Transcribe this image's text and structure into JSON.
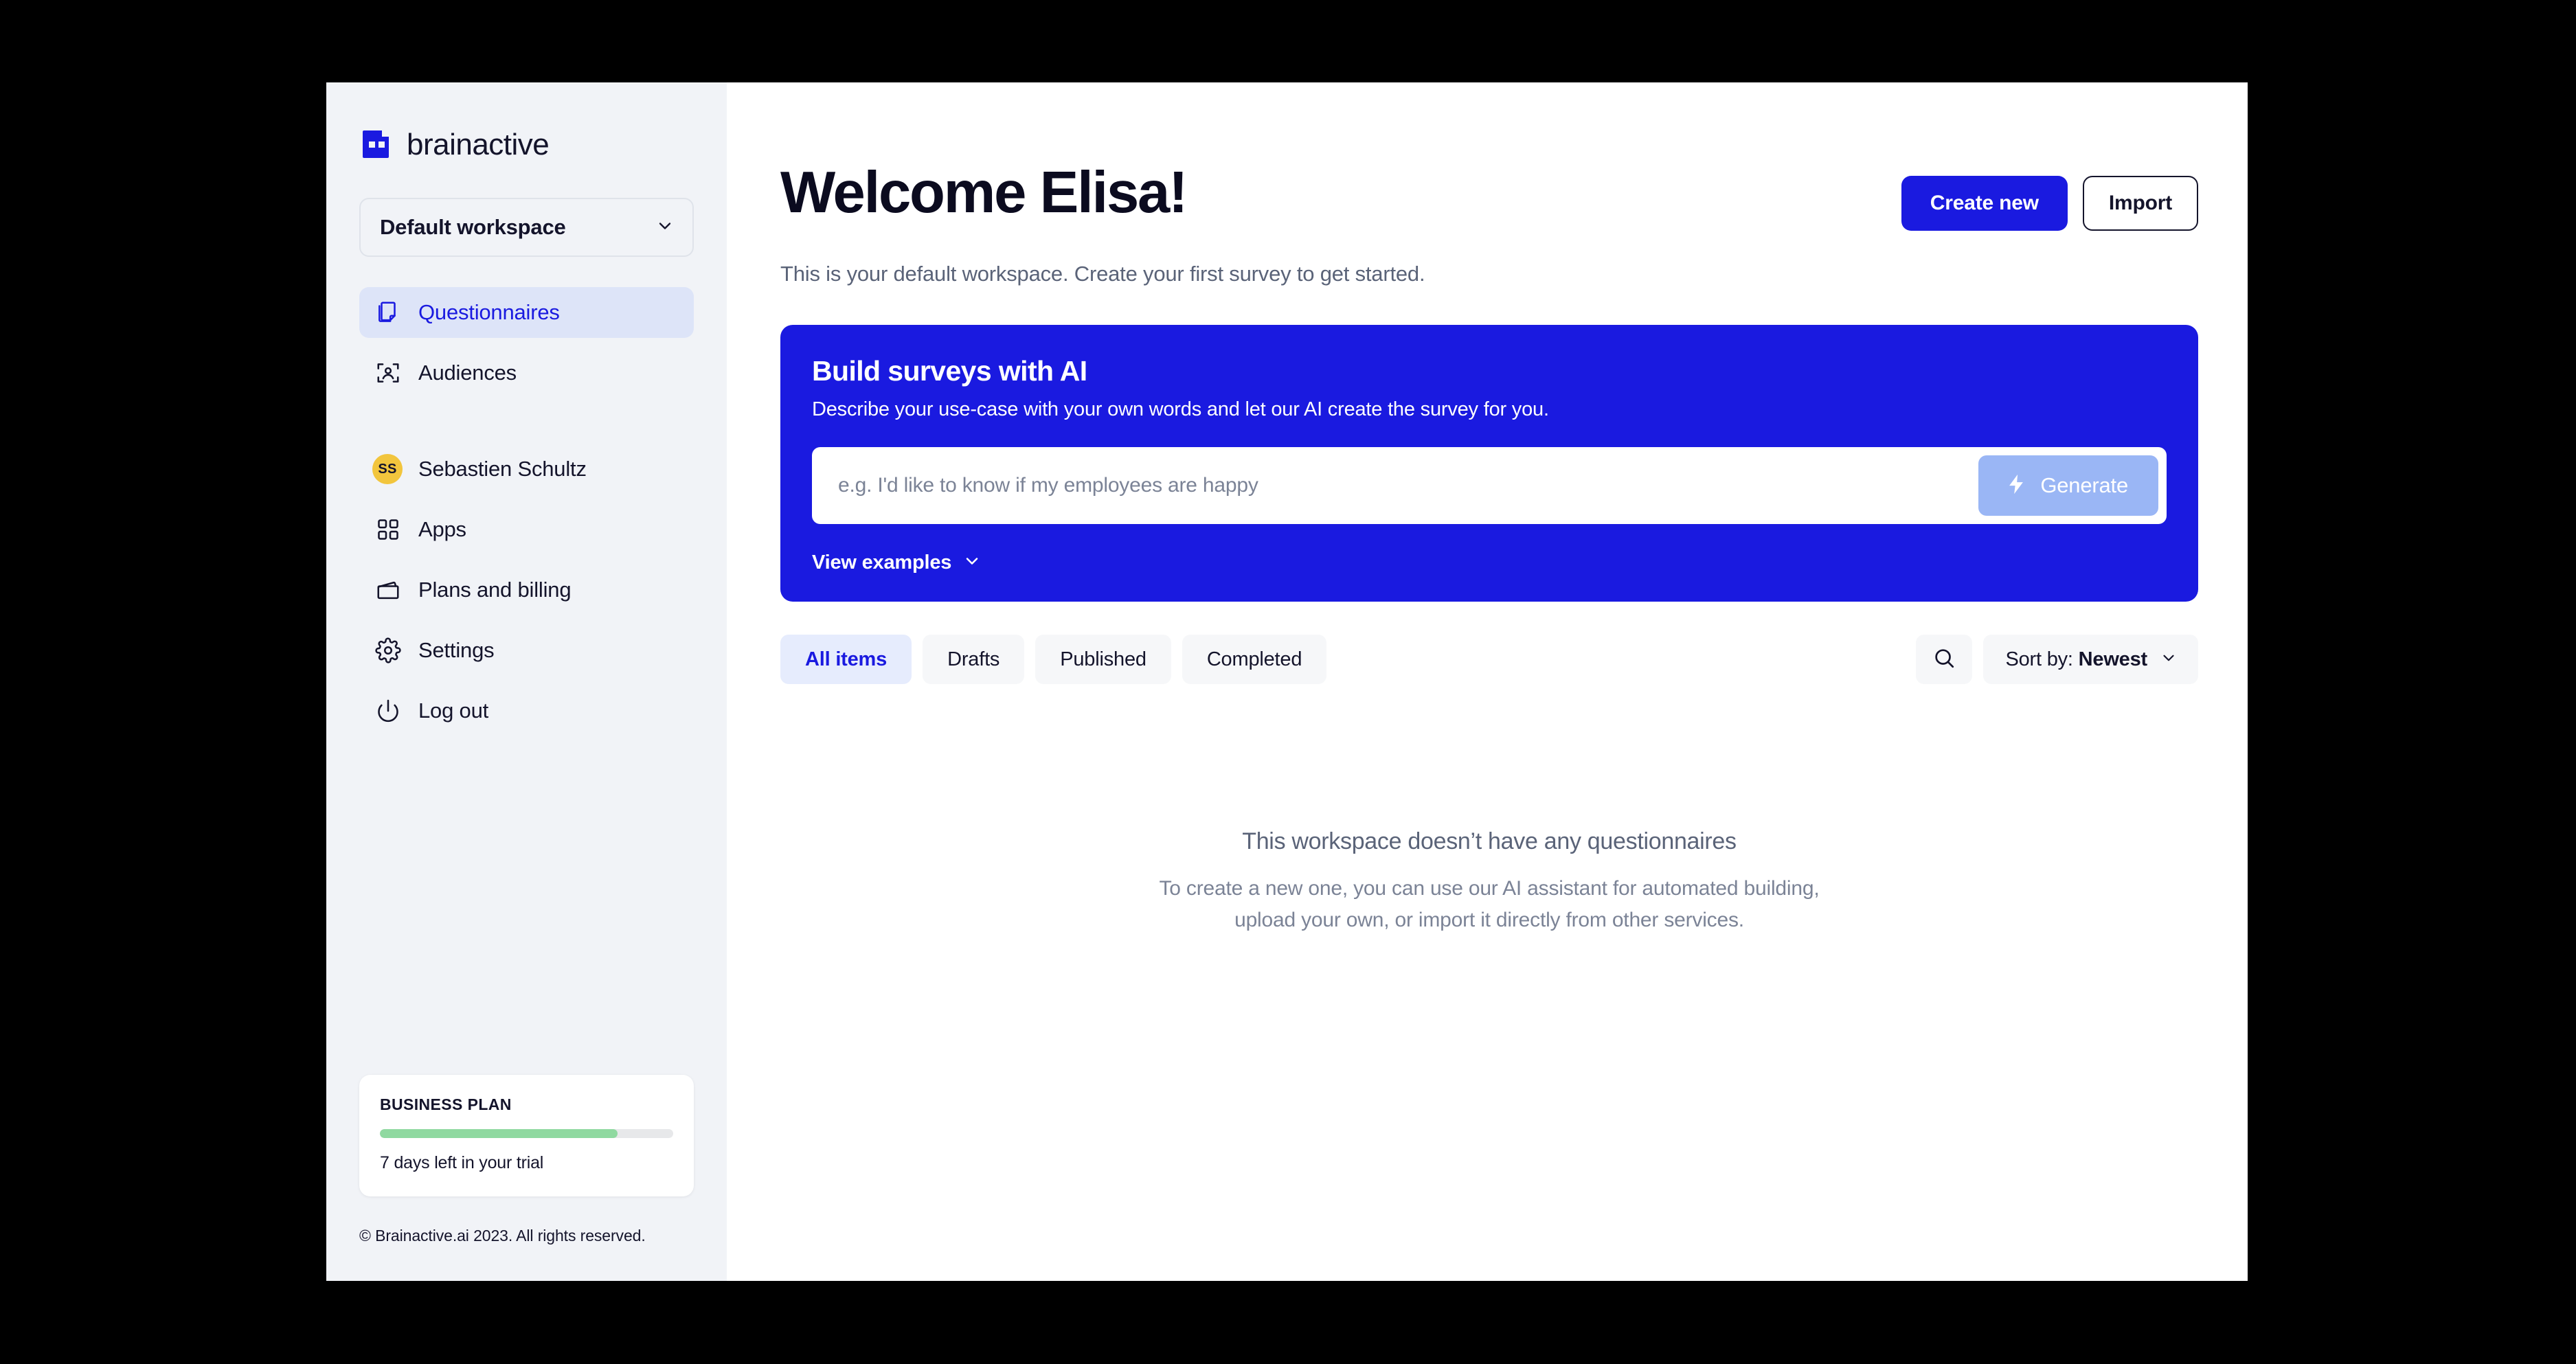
{
  "brand": {
    "name": "brainactive",
    "logo_icon": "brainactive-logo-icon",
    "accent_color": "#1a1ae0"
  },
  "sidebar": {
    "workspace": {
      "label": "Default workspace",
      "chevron_icon": "chevron-down-icon"
    },
    "nav": [
      {
        "label": "Questionnaires",
        "icon": "documents-icon",
        "active": true
      },
      {
        "label": "Audiences",
        "icon": "audience-icon",
        "active": false
      },
      {
        "label": "Sebastien Schultz",
        "icon": "avatar-initials",
        "initials": "SS",
        "avatar_color": "#f2c53d",
        "active": false
      },
      {
        "label": "Apps",
        "icon": "grid-apps-icon",
        "active": false
      },
      {
        "label": "Plans and billing",
        "icon": "wallet-icon",
        "active": false
      },
      {
        "label": "Settings",
        "icon": "gear-icon",
        "active": false
      },
      {
        "label": "Log out",
        "icon": "power-icon",
        "active": false
      }
    ],
    "plan_card": {
      "title": "BUSINESS PLAN",
      "progress_percent": 81,
      "progress_color": "#8fd9a0",
      "subtitle": "7 days left in your trial"
    },
    "copyright": "© Brainactive.ai 2023. All rights reserved."
  },
  "header": {
    "title": "Welcome Elisa!",
    "subtitle": "This is your default workspace. Create your first survey to get started.",
    "create_button": "Create new",
    "import_button": "Import"
  },
  "ai_panel": {
    "title": "Build surveys with AI",
    "description": "Describe your use-case with your own words and let our AI create the survey for you.",
    "input_value": "",
    "input_placeholder": "e.g. I'd like to know if my employees are happy",
    "generate_label": "Generate",
    "generate_icon": "lightning-bolt-icon",
    "generate_color": "#9ab6f5",
    "view_examples_label": "View examples",
    "view_examples_icon": "chevron-down-icon",
    "background_color": "#1a1ae0"
  },
  "toolbar": {
    "filters": [
      {
        "label": "All items",
        "active": true
      },
      {
        "label": "Drafts",
        "active": false
      },
      {
        "label": "Published",
        "active": false
      },
      {
        "label": "Completed",
        "active": false
      }
    ],
    "search_icon": "search-icon",
    "sort_prefix": "Sort by:",
    "sort_value": "Newest",
    "sort_chevron_icon": "chevron-down-icon"
  },
  "empty_state": {
    "title": "This workspace doesn’t have any questionnaires",
    "line1": "To create a new one, you can use our AI assistant for automated building,",
    "line2": "upload your own, or import it directly from other services."
  }
}
